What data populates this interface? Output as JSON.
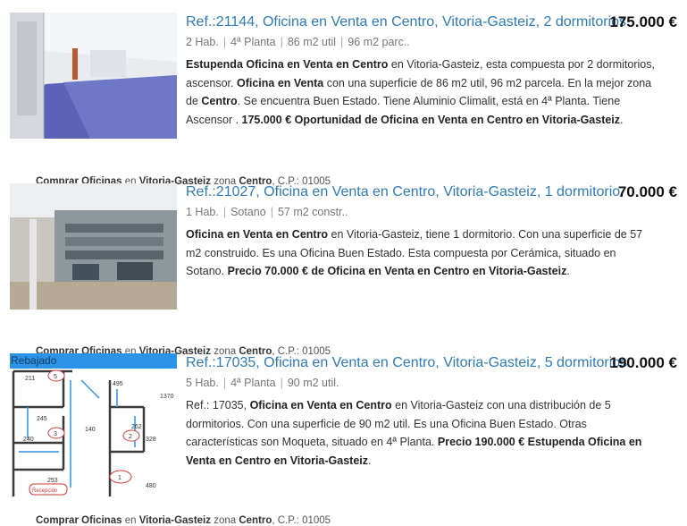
{
  "listings": [
    {
      "title": "Ref.:21144, Oficina en Venta en Centro, Vitoria-Gasteiz, 2 dormitorios.",
      "price": "175.000 €",
      "meta": [
        "2 Hab.",
        "4ª Planta",
        "86 m2 util",
        "96 m2 parc.."
      ],
      "desc": [
        {
          "b": "Estupenda Oficina en Venta en Centro",
          "t": " en Vitoria-Gasteiz, esta compuesta por 2 dormitorios, ascensor. "
        },
        {
          "b": "Oficina en Venta",
          "t": " con una superficie de 86 m2 util, 96 m2 parcela. En la mejor zona de "
        },
        {
          "b": "Centro",
          "t": ". Se encuentra Buen Estado. Tiene Aluminio Climalit, está en 4ª Planta. Tiene Ascensor . "
        },
        {
          "b": "175.000 € Oportunidad de Oficina en Venta en Centro en Vitoria-Gasteiz",
          "t": "."
        }
      ],
      "footer": [
        {
          "b": "Comprar Oficinas",
          "t": " en "
        },
        {
          "b": "Vitoria-Gasteiz",
          "t": " zona "
        },
        {
          "b": "Centro",
          "t": ", C.P.: 01005"
        }
      ]
    },
    {
      "title": "Ref.:21027, Oficina en Venta en Centro, Vitoria-Gasteiz, 1 dormitorio.",
      "price": "70.000 €",
      "meta": [
        "1 Hab.",
        "Sotano",
        "57 m2 constr.."
      ],
      "desc": [
        {
          "b": "Oficina en Venta en Centro",
          "t": " en Vitoria-Gasteiz, tiene 1 dormitorio. Con una superficie de 57 m2 construido. Es una Oficina Buen Estado. Esta compuesta por Cerámica, situado en Sotano. "
        },
        {
          "b": "Precio 70.000 € de Oficina en Venta en Centro en Vitoria-Gasteiz",
          "t": "."
        }
      ],
      "footer": [
        {
          "b": "Comprar Oficinas",
          "t": " en "
        },
        {
          "b": "Vitoria-Gasteiz",
          "t": " zona "
        },
        {
          "b": "Centro",
          "t": ", C.P.: 01005"
        }
      ]
    },
    {
      "badge": "Rebajado",
      "title": "Ref.:17035, Oficina en Venta en Centro, Vitoria-Gasteiz, 5 dormitorios.",
      "price": "190.000 €",
      "meta": [
        "5 Hab.",
        "4ª Planta",
        "90 m2 util."
      ],
      "desc": [
        {
          "b": "",
          "t": "Ref.: 17035, "
        },
        {
          "b": "Oficina en Venta en Centro",
          "t": " en Vitoria-Gasteiz con una distribución de 5 dormitorios. Con una superficie de 90 m2 util. Es una Oficina Buen Estado. Otras características son Moqueta, situado en 4ª Planta. "
        },
        {
          "b": "Precio 190.000 € Estupenda Oficina en Venta en Centro en Vitoria-Gasteiz",
          "t": "."
        }
      ],
      "footer": [
        {
          "b": "Comprar Oficinas",
          "t": " en "
        },
        {
          "b": "Vitoria-Gasteiz",
          "t": " zona "
        },
        {
          "b": "Centro",
          "t": ", C.P.: 01005"
        }
      ],
      "plan": {
        "rooms": [
          "5",
          "3",
          "2",
          "1"
        ],
        "dims": [
          "211",
          "495",
          "1370",
          "245",
          "240",
          "140",
          "262",
          "328",
          "253",
          "480"
        ],
        "label": "Recepción"
      }
    }
  ]
}
